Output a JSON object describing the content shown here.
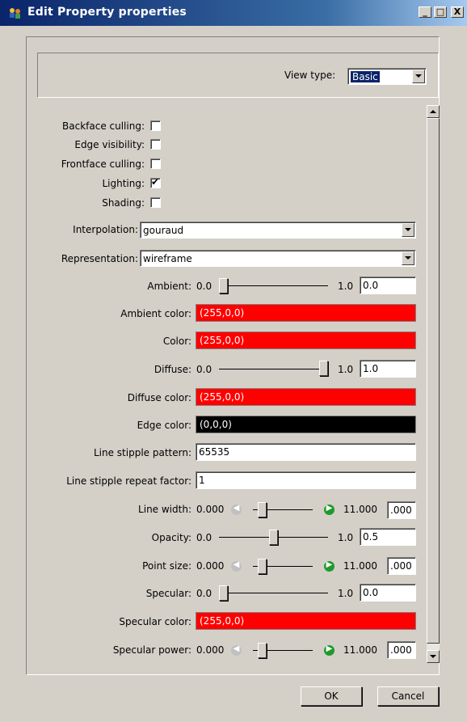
{
  "window": {
    "title": "Edit Property properties"
  },
  "titlebar_buttons": {
    "minimize": "_",
    "maximize": "□",
    "close": "X"
  },
  "view": {
    "label": "View type:",
    "value": "Basic"
  },
  "checkboxes": [
    {
      "label": "Backface culling:",
      "checked": false
    },
    {
      "label": "Edge visibility:",
      "checked": false
    },
    {
      "label": "Frontface culling:",
      "checked": false
    },
    {
      "label": "Lighting:",
      "checked": true,
      "mark": "✔"
    },
    {
      "label": "Shading:",
      "checked": false
    }
  ],
  "interpolation": {
    "label": "Interpolation:",
    "value": "gouraud"
  },
  "representation": {
    "label": "Representation:",
    "value": "wireframe"
  },
  "ambient": {
    "label": "Ambient:",
    "min": "0.0",
    "max": "1.0",
    "value": "0.0",
    "level": 0.0
  },
  "ambient_color": {
    "label": "Ambient color:",
    "value": "(255,0,0)",
    "color": "#ff0000"
  },
  "color": {
    "label": "Color:",
    "value": "(255,0,0)",
    "color": "#ff0000"
  },
  "diffuse": {
    "label": "Diffuse:",
    "min": "0.0",
    "max": "1.0",
    "value": "1.0",
    "level": 1.0
  },
  "diffuse_color": {
    "label": "Diffuse color:",
    "value": "(255,0,0)",
    "color": "#ff0000"
  },
  "edge_color": {
    "label": "Edge color:",
    "value": "(0,0,0)",
    "color": "#000000"
  },
  "line_stipple_pattern": {
    "label": "Line stipple pattern:",
    "value": "65535"
  },
  "line_stipple_repeat": {
    "label": "Line stipple repeat factor:",
    "value": "1"
  },
  "line_width": {
    "label": "Line width:",
    "min": "0.000",
    "max": "11.000",
    "value": ".000",
    "level": 0.09
  },
  "opacity": {
    "label": "Opacity:",
    "min": "0.0",
    "max": "1.0",
    "value": "0.5",
    "level": 0.5
  },
  "point_size": {
    "label": "Point size:",
    "min": "0.000",
    "max": "11.000",
    "value": ".000",
    "level": 0.09
  },
  "specular": {
    "label": "Specular:",
    "min": "0.0",
    "max": "1.0",
    "value": "0.0",
    "level": 0.0
  },
  "specular_color": {
    "label": "Specular color:",
    "value": "(255,0,0)",
    "color": "#ff0000"
  },
  "specular_power": {
    "label": "Specular power:",
    "min": "0.000",
    "max": "11.000",
    "value": ".000",
    "level": 0.09
  },
  "icons": {
    "step_left": "◀",
    "step_right": "▶"
  },
  "buttons": {
    "ok": "OK",
    "cancel": "Cancel"
  }
}
